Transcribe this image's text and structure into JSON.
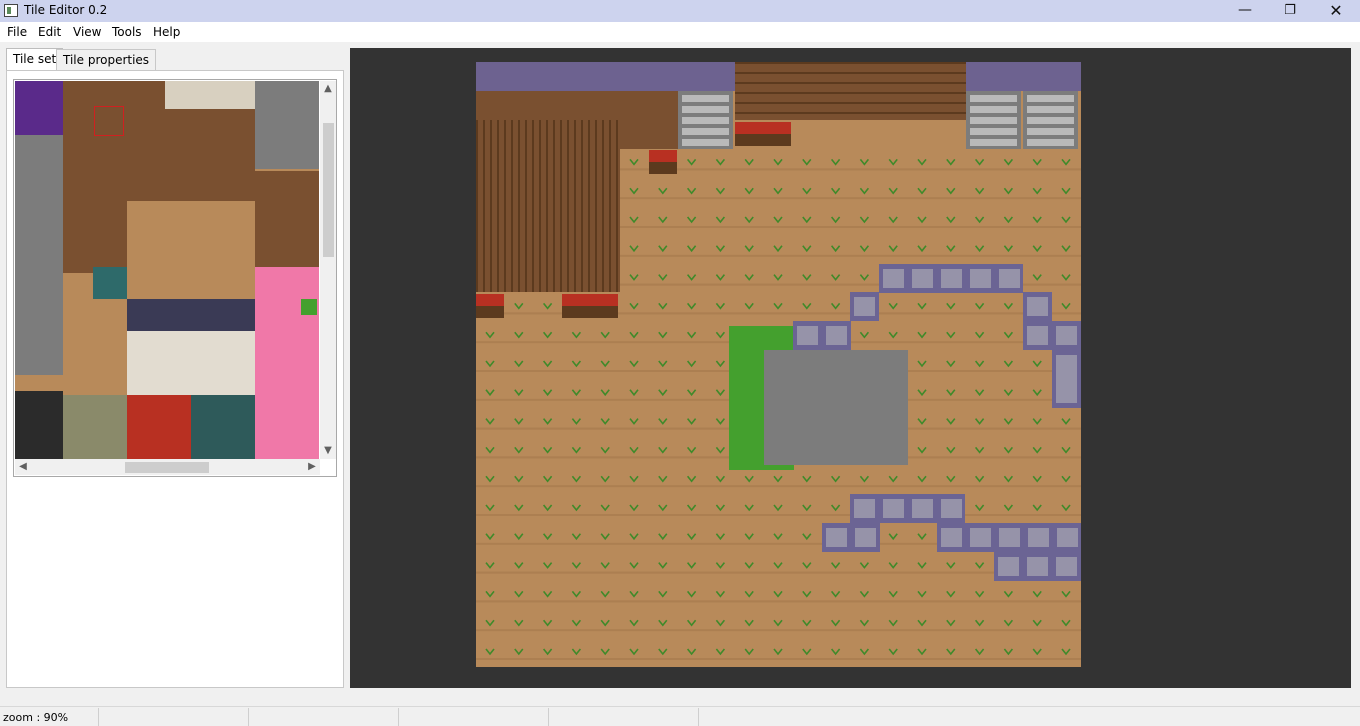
{
  "window": {
    "title": "Tile Editor 0.2",
    "minimize_glyph": "—",
    "restore_glyph": "❐",
    "close_glyph": "✕"
  },
  "menu": {
    "items": [
      "File",
      "Edit",
      "View",
      "Tools",
      "Help"
    ]
  },
  "tabs": {
    "tile_set": "Tile set",
    "tile_properties": "Tile properties"
  },
  "scroll": {
    "up": "▲",
    "down": "▼",
    "left": "◀",
    "right": "▶"
  },
  "status": {
    "zoom": "zoom : 90%"
  },
  "colors": {
    "dirt": "#b88a5a",
    "dirt_dark": "#a07448",
    "sprout": "#3f8a2a",
    "grass": "#44a02e",
    "wood": "#7a5030",
    "wood_dark": "#5c3a1e",
    "roof_stone": "#6d6290",
    "stone": "#7c7c7c",
    "stone_light": "#b9b9b9",
    "purple_wall": "#6b6494",
    "crate_red": "#b83022",
    "pink": "#f078a8"
  }
}
